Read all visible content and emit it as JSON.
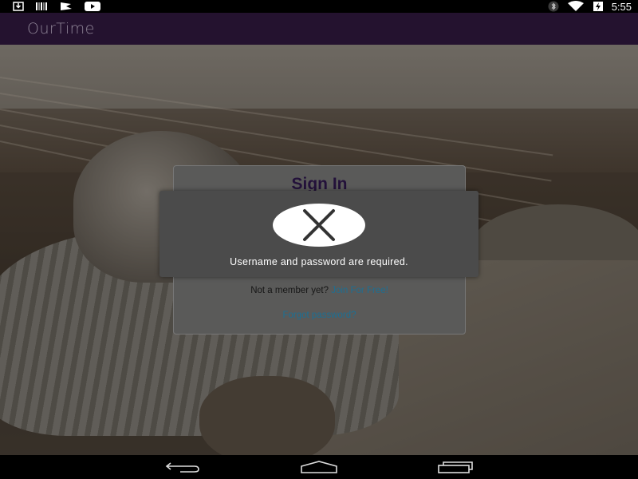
{
  "status_bar": {
    "time": "5:55",
    "left_icons": [
      "download-icon",
      "barcode-icon",
      "flag-icon",
      "youtube-icon"
    ],
    "right_icons": [
      "bluetooth-icon",
      "wifi-icon",
      "battery-charging-icon"
    ]
  },
  "app_bar": {
    "logo_text": "OurTime"
  },
  "sign_in": {
    "title": "Sign In",
    "not_member_text": "Not a member yet?",
    "join_link": "Join For Free!",
    "forgot_link": "Forgot password?"
  },
  "error_toast": {
    "icon": "close-icon",
    "message": "Username and password are required."
  },
  "nav_bar": {
    "buttons": [
      "back",
      "home",
      "recent-apps"
    ]
  },
  "colors": {
    "app_bar_bg": "#24122f",
    "link": "#1d6f93",
    "title": "#23113a",
    "toast_bg": "#4b4b4b"
  }
}
